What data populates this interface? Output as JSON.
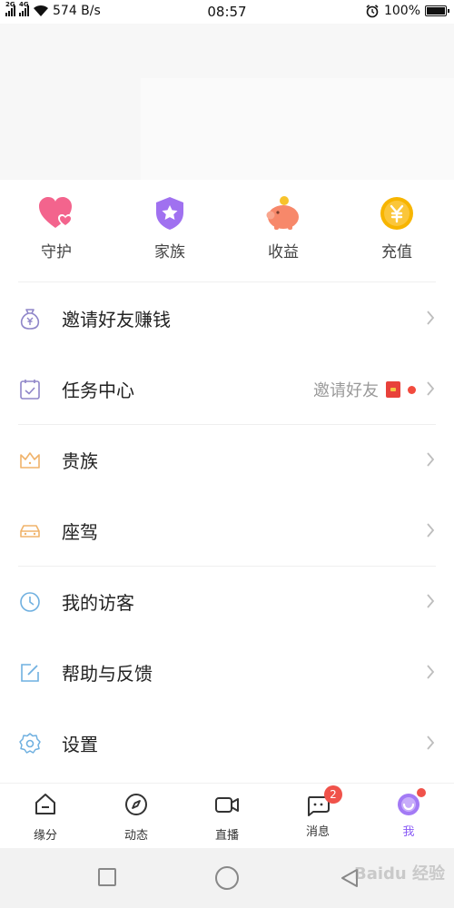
{
  "status_bar": {
    "net_label_2g": "2G",
    "net_label_4g": "4G",
    "speed": "574 B/s",
    "time": "08:57",
    "battery": "100%"
  },
  "quick_actions": [
    {
      "label": "守护",
      "icon": "heart-icon"
    },
    {
      "label": "家族",
      "icon": "shield-star-icon"
    },
    {
      "label": "收益",
      "icon": "piggy-bank-icon"
    },
    {
      "label": "充值",
      "icon": "yen-coin-icon"
    }
  ],
  "menu": {
    "invite": {
      "label": "邀请好友赚钱",
      "icon": "money-bag-icon"
    },
    "tasks": {
      "label": "任务中心",
      "icon": "task-check-icon",
      "extra": "邀请好友"
    },
    "nobility": {
      "label": "贵族",
      "icon": "crown-icon"
    },
    "mount": {
      "label": "座驾",
      "icon": "car-icon"
    },
    "visitors": {
      "label": "我的访客",
      "icon": "clock-icon"
    },
    "feedback": {
      "label": "帮助与反馈",
      "icon": "edit-icon"
    },
    "settings": {
      "label": "设置",
      "icon": "gear-icon"
    }
  },
  "bottom_nav": [
    {
      "label": "缘分",
      "icon": "home-icon"
    },
    {
      "label": "动态",
      "icon": "compass-icon"
    },
    {
      "label": "直播",
      "icon": "video-icon"
    },
    {
      "label": "消息",
      "icon": "chat-icon",
      "badge": "2"
    },
    {
      "label": "我",
      "icon": "profile-icon"
    }
  ],
  "watermark": "Baidu 经验",
  "colors": {
    "accent": "#8a5cf6",
    "badge": "#f0524a",
    "divider": "#efefef"
  }
}
